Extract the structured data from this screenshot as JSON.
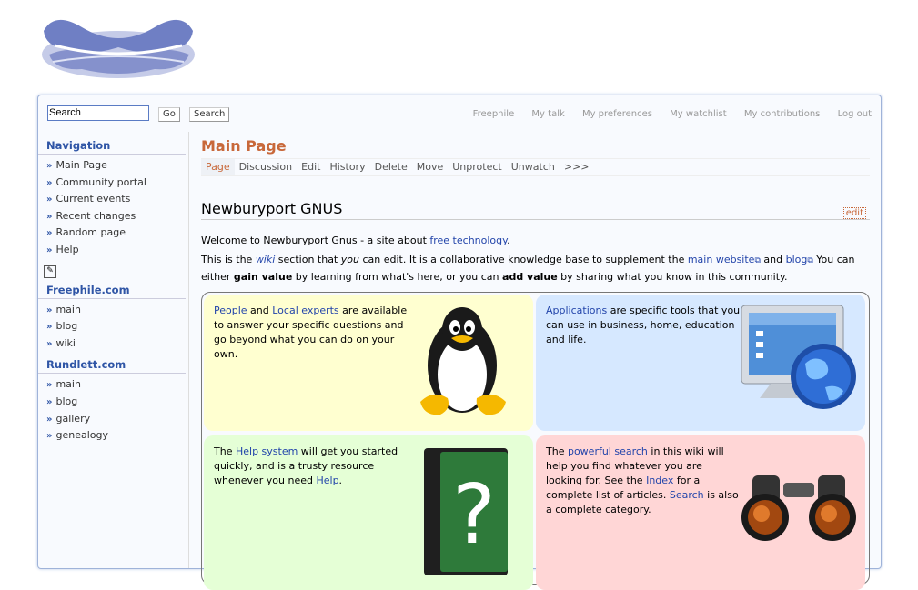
{
  "search": {
    "value": "Search",
    "go_label": "Go",
    "search_label": "Search"
  },
  "personal": [
    "Freephile",
    "My talk",
    "My preferences",
    "My watchlist",
    "My contributions",
    "Log out"
  ],
  "sidebar": {
    "navigation": {
      "title": "Navigation",
      "items": [
        "Main Page",
        "Community portal",
        "Current events",
        "Recent changes",
        "Random page",
        "Help"
      ]
    },
    "freephile": {
      "title": "Freephile.com",
      "items": [
        "main",
        "blog",
        "wiki"
      ]
    },
    "rundlett": {
      "title": "Rundlett.com",
      "items": [
        "main",
        "blog",
        "gallery",
        "genealogy"
      ]
    }
  },
  "page": {
    "title": "Main Page",
    "tabs": [
      "Page",
      "Discussion",
      "Edit",
      "History",
      "Delete",
      "Move",
      "Unprotect",
      "Unwatch",
      ">>>"
    ],
    "heading": "Newburyport GNUS",
    "edit_label": "edit",
    "welcome": {
      "pre": "Welcome to Newburyport Gnus - a site about ",
      "link": "free technology",
      "post": "."
    },
    "intro": {
      "t1": "This is the ",
      "wiki": "wiki",
      "t2": " section that ",
      "you": "you",
      "t3": " can edit. It is a collaborative knowledge base to supplement the ",
      "main_website": "main website",
      "t4": " and ",
      "blog": "blog",
      "t5": " You can either ",
      "gain": "gain value",
      "t6": " by learning from what's here, or you can ",
      "add": "add value",
      "t7": " by sharing what you know in this community."
    }
  },
  "boxes": {
    "people": {
      "l1": "People",
      "t1": " and ",
      "l2": "Local experts",
      "t2": " are available to answer your specific questions and go beyond what you can do on your own."
    },
    "applications": {
      "l1": "Applications",
      "t1": " are specific tools that you can use in business, home, education and life."
    },
    "help": {
      "t0": "The ",
      "l1": "Help system",
      "t1": " will get you started quickly, and is a trusty resource whenever you need ",
      "l2": "Help",
      "t2": "."
    },
    "search": {
      "t0": "The ",
      "l1": "powerful search",
      "t1": " in this wiki will help you find whatever you are looking for. See the ",
      "l2": "Index",
      "t2": " for a complete list of articles. ",
      "l3": "Search",
      "t3": " is also a complete category."
    }
  },
  "colors": {
    "accent": "#c8683a",
    "link": "#2244aa",
    "nav_title": "#2f55a6"
  },
  "icons": {
    "logo": "gnu-logo-icon",
    "people": "penguin-icon",
    "applications": "computer-globe-icon",
    "help": "question-book-icon",
    "search": "binoculars-icon",
    "edit_toolbox": "edit-pen-icon"
  }
}
